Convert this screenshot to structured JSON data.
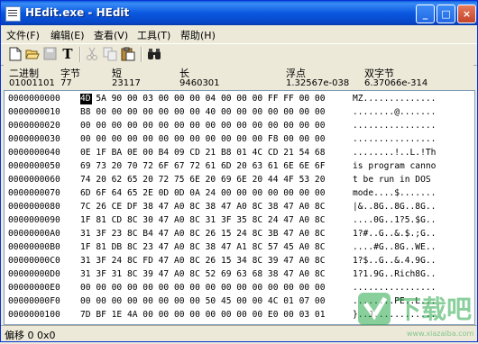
{
  "window": {
    "title": "HEdit.exe - HEdit"
  },
  "titlebar_buttons": {
    "minimize": "_",
    "maximize": "□",
    "close": "×"
  },
  "menu": [
    {
      "label": "文件(F)"
    },
    {
      "label": "编辑(E)"
    },
    {
      "label": "查看(V)"
    },
    {
      "label": "工具(T)"
    },
    {
      "label": "帮助(H)"
    }
  ],
  "toolbar": {
    "icons": [
      "new-file-icon",
      "open-folder-icon",
      "save-icon",
      "text-mode-icon",
      "cut-icon",
      "copy-icon",
      "paste-icon",
      "find-icon"
    ],
    "text_mode_label": "T"
  },
  "info": {
    "binary": {
      "label": "二进制",
      "value": "01001101"
    },
    "byte": {
      "label": "字节",
      "value": "77"
    },
    "short": {
      "label": "短",
      "value": "23117"
    },
    "long": {
      "label": "长",
      "value": "9460301"
    },
    "float": {
      "label": "浮点",
      "value": "1.32567e-038"
    },
    "double": {
      "label": "双字节",
      "value": "6.37066e-314"
    }
  },
  "hex_rows": [
    {
      "offset": "0000000000",
      "hex": "4D 5A 90 00 03 00 00 00 04 00 00 00 FF FF 00 00",
      "ascii": "MZ.............."
    },
    {
      "offset": "0000000010",
      "hex": "B8 00 00 00 00 00 00 00 40 00 00 00 00 00 00 00",
      "ascii": "........@......."
    },
    {
      "offset": "0000000020",
      "hex": "00 00 00 00 00 00 00 00 00 00 00 00 00 00 00 00",
      "ascii": "................"
    },
    {
      "offset": "0000000030",
      "hex": "00 00 00 00 00 00 00 00 00 00 00 00 F8 00 00 00",
      "ascii": "................"
    },
    {
      "offset": "0000000040",
      "hex": "0E 1F BA 0E 00 B4 09 CD 21 B8 01 4C CD 21 54 68",
      "ascii": "........!..L.!Th"
    },
    {
      "offset": "0000000050",
      "hex": "69 73 20 70 72 6F 67 72 61 6D 20 63 61 6E 6E 6F",
      "ascii": "is program canno"
    },
    {
      "offset": "0000000060",
      "hex": "74 20 62 65 20 72 75 6E 20 69 6E 20 44 4F 53 20",
      "ascii": "t be run in DOS "
    },
    {
      "offset": "0000000070",
      "hex": "6D 6F 64 65 2E 0D 0D 0A 24 00 00 00 00 00 00 00",
      "ascii": "mode....$......."
    },
    {
      "offset": "0000000080",
      "hex": "7C 26 CE DF 38 47 A0 8C 38 47 A0 8C 38 47 A0 8C",
      "ascii": "|&..8G..8G..8G.."
    },
    {
      "offset": "0000000090",
      "hex": "1F 81 CD 8C 30 47 A0 8C 31 3F 35 8C 24 47 A0 8C",
      "ascii": "....0G..1?5.$G.."
    },
    {
      "offset": "00000000A0",
      "hex": "31 3F 23 8C B4 47 A0 8C 26 15 24 8C 3B 47 A0 8C",
      "ascii": "1?#..G..&.$.;G.."
    },
    {
      "offset": "00000000B0",
      "hex": "1F 81 DB 8C 23 47 A0 8C 38 47 A1 8C 57 45 A0 8C",
      "ascii": "....#G..8G..WE.."
    },
    {
      "offset": "00000000C0",
      "hex": "31 3F 24 8C FD 47 A0 8C 26 15 34 8C 39 47 A0 8C",
      "ascii": "1?$..G..&.4.9G.."
    },
    {
      "offset": "00000000D0",
      "hex": "31 3F 31 8C 39 47 A0 8C 52 69 63 68 38 47 A0 8C",
      "ascii": "1?1.9G..Rich8G.."
    },
    {
      "offset": "00000000E0",
      "hex": "00 00 00 00 00 00 00 00 00 00 00 00 00 00 00 00",
      "ascii": "................"
    },
    {
      "offset": "00000000F0",
      "hex": "00 00 00 00 00 00 00 00 50 45 00 00 4C 01 07 00",
      "ascii": "........PE..L..."
    },
    {
      "offset": "0000000100",
      "hex": "7D BF 1E 4A 00 00 00 00 00 00 00 00 E0 00 03 01",
      "ascii": "}..J............"
    }
  ],
  "status": {
    "text": "偏移 0 0x0"
  },
  "watermark": {
    "text": "下载吧",
    "url_text": "www.xiazaiba.com"
  }
}
